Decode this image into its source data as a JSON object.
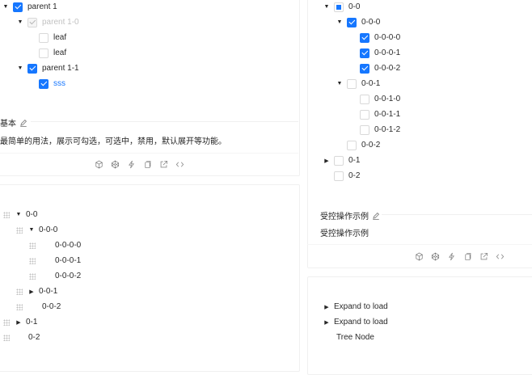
{
  "left_top_demo": {
    "tree": [
      {
        "label": "parent 1"
      },
      {
        "label": "parent 1-0"
      },
      {
        "label": "leaf"
      },
      {
        "label": "leaf"
      },
      {
        "label": "parent 1-1"
      },
      {
        "label": "sss"
      }
    ],
    "title": "基本",
    "description": "最简单的用法，展示可勾选，可选中，禁用，默认展开等功能。"
  },
  "left_bottom_demo": {
    "tree": [
      {
        "label": "0-0"
      },
      {
        "label": "0-0-0"
      },
      {
        "label": "0-0-0-0"
      },
      {
        "label": "0-0-0-1"
      },
      {
        "label": "0-0-0-2"
      },
      {
        "label": "0-0-1"
      },
      {
        "label": "0-0-2"
      },
      {
        "label": "0-1"
      },
      {
        "label": "0-2"
      }
    ]
  },
  "right_top_demo": {
    "tree": [
      {
        "label": "0-0"
      },
      {
        "label": "0-0-0"
      },
      {
        "label": "0-0-0-0"
      },
      {
        "label": "0-0-0-1"
      },
      {
        "label": "0-0-0-2"
      },
      {
        "label": "0-0-1"
      },
      {
        "label": "0-0-1-0"
      },
      {
        "label": "0-0-1-1"
      },
      {
        "label": "0-0-1-2"
      },
      {
        "label": "0-0-2"
      },
      {
        "label": "0-1"
      },
      {
        "label": "0-2"
      }
    ],
    "title": "受控操作示例",
    "description": "受控操作示例"
  },
  "right_bottom_demo": {
    "tree": [
      {
        "label": "Expand to load"
      },
      {
        "label": "Expand to load"
      },
      {
        "label": "Tree Node"
      }
    ]
  },
  "colors": {
    "primary": "#1677ff",
    "border": "#f0f0f0"
  },
  "icons": [
    "edit-icon",
    "codesandbox-icon",
    "codepen-icon",
    "thunderbolt-icon",
    "copy-icon",
    "external-link-icon",
    "code-icon",
    "drag-handle-icon",
    "caret-down-icon",
    "caret-right-icon"
  ]
}
